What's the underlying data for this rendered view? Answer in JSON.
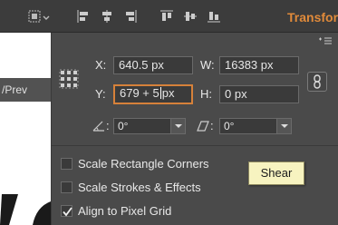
{
  "toolbar": {
    "icons": [
      "align-to-icon",
      "align-left-icon",
      "align-center-icon",
      "align-right-icon",
      "align-top-icon",
      "align-middle-icon",
      "align-bottom-icon"
    ],
    "transform_label": "Transform"
  },
  "document": {
    "tab_label": "/Prev"
  },
  "panel": {
    "x_label": "X:",
    "x_value": "640.5 px",
    "w_label": "W:",
    "w_value": "16383 px",
    "y_label": "Y:",
    "y_value_before_caret": "679 + 5",
    "y_value_after_caret": "px",
    "h_label": "H:",
    "h_value": "0 px",
    "rotate_value": "0°",
    "shear_value": "0°",
    "angle_separator": ":",
    "options": [
      {
        "label": "Scale Rectangle Corners",
        "checked": false
      },
      {
        "label": "Scale Strokes & Effects",
        "checked": false
      },
      {
        "label": "Align to Pixel Grid",
        "checked": true
      }
    ],
    "tooltip": "Shear"
  },
  "colors": {
    "accent": "#e08a3a",
    "panel_bg": "#4a4a4a",
    "field_bg": "#3a3a3a",
    "active_border": "#d6813a",
    "tooltip_bg": "#f7f3c0"
  }
}
